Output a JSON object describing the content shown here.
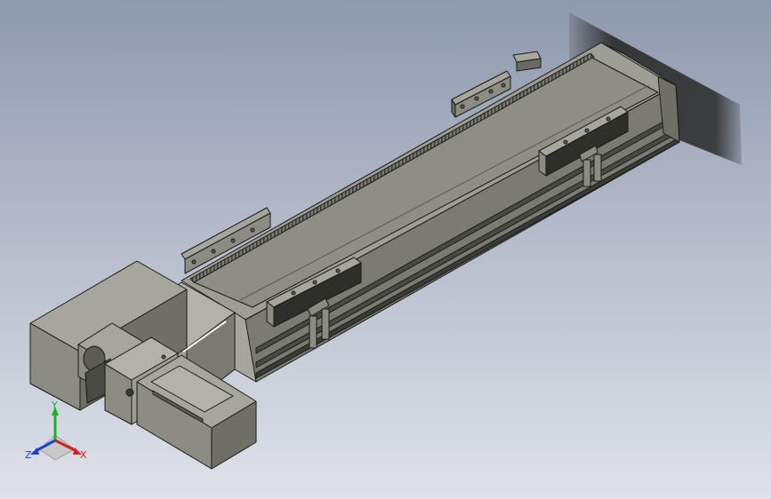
{
  "triad": {
    "x_label": "X",
    "y_label": "Y",
    "z_label": "Z"
  },
  "colors": {
    "bg_top": "#8f99ad",
    "bg_bottom": "#dfe2ea",
    "body_light": "#a6a69c",
    "body_mid": "#8c8c82",
    "body_dark": "#5c5c55",
    "edge": "#1a1a1a",
    "x_axis": "#d42020",
    "y_axis": "#1fae2a",
    "z_axis": "#2040d0"
  }
}
